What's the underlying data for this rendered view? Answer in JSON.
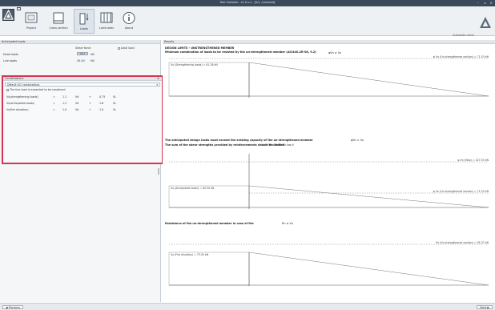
{
  "window": {
    "title": "Mac Carbofor - v1.0.x.x - [5/1, /unsaved]",
    "min": "–",
    "restore": "▫",
    "close": "×"
  },
  "ribbon": {
    "buttons": [
      {
        "id": "project",
        "label": "Project"
      },
      {
        "id": "cross_section",
        "label": "Cross section"
      },
      {
        "id": "loads",
        "label": "Loads"
      },
      {
        "id": "laminates",
        "label": "Laminates"
      },
      {
        "id": "about",
        "label": "About"
      }
    ],
    "right_label": "Automatic check"
  },
  "left": {
    "header": "Anticipated loads",
    "col_shear": "Shear force",
    "axial_load": "Axial load",
    "dead_loads_label": "Dead loads",
    "dead_loads_value": "32.1",
    "dead_loads_unit": "kN",
    "live_loads_label": "Live loads",
    "live_loads_value": "45.00",
    "live_loads_unit": "kN"
  },
  "combinations": {
    "header": "Combinations",
    "selected": "Default ACI combinations",
    "checkbox_label": "The live load is expected to be sustained",
    "rows": [
      {
        "label": "Vu(strengthening loads)",
        "eq": "=",
        "a": "1.1",
        "a_sym": "Vd",
        "plus": "+",
        "b": "0.75",
        "b_sym": "VL"
      },
      {
        "label": "Vu(anticipated loads)",
        "eq": "=",
        "a": "1.2",
        "a_sym": "Vd",
        "plus": "+",
        "b": "1.6",
        "b_sym": "VL"
      },
      {
        "label": "Vu(fire situation)",
        "eq": "=",
        "a": "1.0",
        "a_sym": "Vd",
        "plus": "+",
        "b": "1.0",
        "b_sym": "VL"
      }
    ]
  },
  "results": {
    "header": "Results",
    "title": "DESIGN LIMITS - UNSTRENGTHENED MEMBER",
    "s1_text": "Minimum combination of loads to be resisted by the un-strengthened member (ACI440.2R-08, 9.2)",
    "s1_formula": "φVn ≥ Vu",
    "s1_top": "φ Vn (Un-strengthened section) = 71.53 kN",
    "s1_box": "Vu (Strengthening loads) = 61.38 kN",
    "s2_text": "The anticipated design loads must exceed the existing capacity of the un-strengthened member",
    "s2_formula_1": "φVn > Vu",
    "s2_text_b": "The sum of the shear strengths provided by reinforcements should be limited",
    "s2_formula_2": "Vs + Vf ≤ 0.66√f'c bw d",
    "s2_top": "φ Vn (Max) = 227.53 kN",
    "s2_mid": "φ Vn (Un-strengthened section) = 71.53 kN",
    "s2_box": "Vu (Anticipated loads) = 83.30 kN",
    "s3_text": "Resistance of the un-strengthened member in case of fire",
    "s3_formula": "Rn ≥ Vu",
    "s3_top": "Vn (Un-strengthened section) = 95.37 kN",
    "s3_box": "Vu (Fire situation) = 75.55 kN"
  },
  "nav": {
    "previous": "Previous",
    "next": "Next"
  },
  "colors": {
    "accent": "#d8344f",
    "title_bar": "#3a4a5c",
    "input_fill": "#c9d3de"
  }
}
